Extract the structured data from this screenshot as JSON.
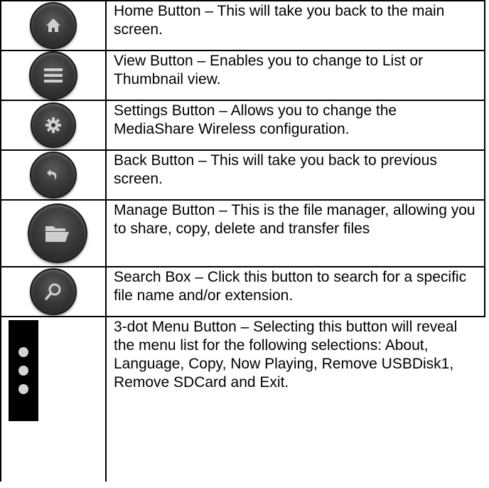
{
  "rows": [
    {
      "icon": "home-icon",
      "text": "Home Button – This will take you back to the main screen."
    },
    {
      "icon": "list-view-icon",
      "text": "View Button – Enables you to change to List or Thumbnail view."
    },
    {
      "icon": "gear-icon",
      "text": "Settings Button – Allows you to change the MediaShare Wireless configuration."
    },
    {
      "icon": "back-arrow-icon",
      "text": "Back Button – This will take you back to previous screen."
    },
    {
      "icon": "folder-icon",
      "text": "Manage Button – This is the file manager, allowing you to share, copy, delete and transfer files"
    },
    {
      "icon": "search-icon",
      "text": "Search Box – Click this button to search for a specific file name and/or extension."
    },
    {
      "icon": "three-dot-menu-icon",
      "text": "3-dot Menu Button – Selecting this button will reveal the menu list for the following selections: About, Language, Copy, Now Playing, Remove USBDisk1, Remove SDCard and Exit."
    }
  ],
  "colors": {
    "button_dark": "#2e2e2e",
    "icon_light": "#cfcfcf",
    "border": "#000000"
  }
}
